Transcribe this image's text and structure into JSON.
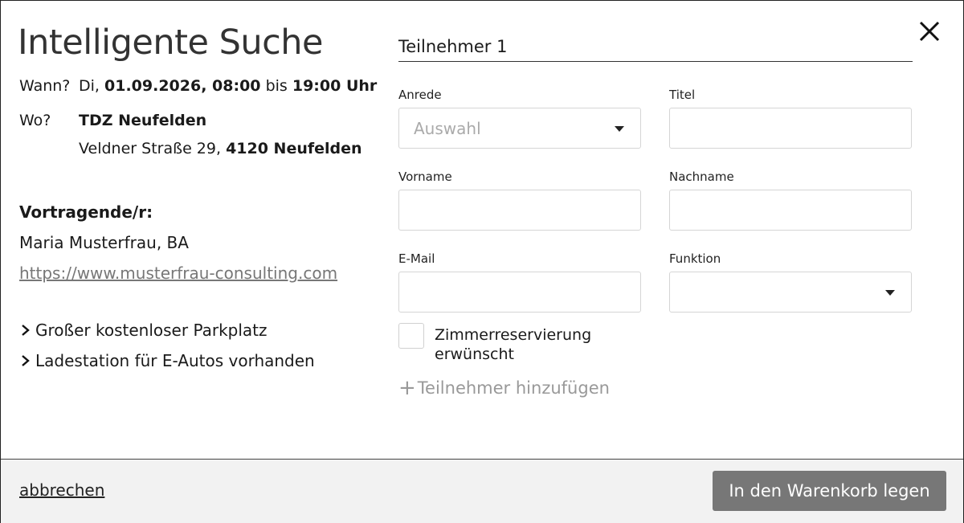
{
  "dialog": {
    "title": "Intelligente Suche",
    "close_icon": "close-icon"
  },
  "event": {
    "when_label": "Wann?",
    "when_day": "Di,",
    "when_date_start": "01.09.2026, 08:00",
    "when_bis": "bis",
    "when_end": "19:00 Uhr",
    "where_label": "Wo?",
    "venue": "TDZ Neufelden",
    "street": "Veldner Straße 29,",
    "city": "4120 Neufelden"
  },
  "speaker": {
    "heading": "Vortragende/r:",
    "name": "Maria Musterfrau, BA",
    "link": "https://www.musterfrau-consulting.com"
  },
  "features": [
    "Großer kostenloser Parkplatz",
    "Ladestation für E-Autos vorhanden"
  ],
  "form": {
    "participant_title": "Teilnehmer 1",
    "anrede_label": "Anrede",
    "anrede_placeholder": "Auswahl",
    "titel_label": "Titel",
    "vorname_label": "Vorname",
    "nachname_label": "Nachname",
    "email_label": "E-Mail",
    "funktion_label": "Funktion",
    "zimmer_label": "Zimmerreservierung erwünscht",
    "add_participant": "Teilnehmer hinzufügen"
  },
  "footer": {
    "cancel_label": "abbrechen",
    "cart_label": "In den Warenkorb legen"
  },
  "colors": {
    "button_bg": "#777777",
    "footer_bg": "#f2f2f2",
    "link": "#777777"
  }
}
